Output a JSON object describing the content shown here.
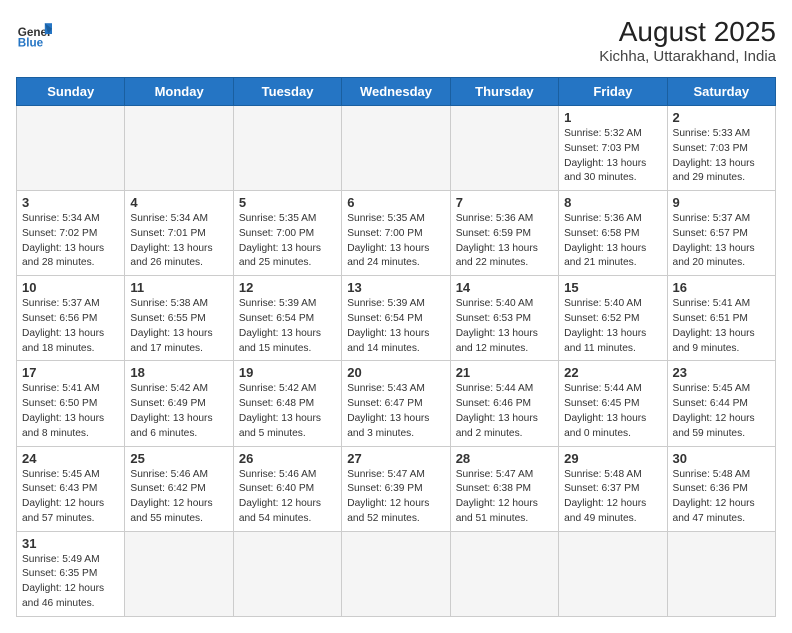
{
  "header": {
    "logo_general": "General",
    "logo_blue": "Blue",
    "title": "August 2025",
    "subtitle": "Kichha, Uttarakhand, India"
  },
  "days_of_week": [
    "Sunday",
    "Monday",
    "Tuesday",
    "Wednesday",
    "Thursday",
    "Friday",
    "Saturday"
  ],
  "weeks": [
    [
      {
        "day": "",
        "info": ""
      },
      {
        "day": "",
        "info": ""
      },
      {
        "day": "",
        "info": ""
      },
      {
        "day": "",
        "info": ""
      },
      {
        "day": "",
        "info": ""
      },
      {
        "day": "1",
        "info": "Sunrise: 5:32 AM\nSunset: 7:03 PM\nDaylight: 13 hours and 30 minutes."
      },
      {
        "day": "2",
        "info": "Sunrise: 5:33 AM\nSunset: 7:03 PM\nDaylight: 13 hours and 29 minutes."
      }
    ],
    [
      {
        "day": "3",
        "info": "Sunrise: 5:34 AM\nSunset: 7:02 PM\nDaylight: 13 hours and 28 minutes."
      },
      {
        "day": "4",
        "info": "Sunrise: 5:34 AM\nSunset: 7:01 PM\nDaylight: 13 hours and 26 minutes."
      },
      {
        "day": "5",
        "info": "Sunrise: 5:35 AM\nSunset: 7:00 PM\nDaylight: 13 hours and 25 minutes."
      },
      {
        "day": "6",
        "info": "Sunrise: 5:35 AM\nSunset: 7:00 PM\nDaylight: 13 hours and 24 minutes."
      },
      {
        "day": "7",
        "info": "Sunrise: 5:36 AM\nSunset: 6:59 PM\nDaylight: 13 hours and 22 minutes."
      },
      {
        "day": "8",
        "info": "Sunrise: 5:36 AM\nSunset: 6:58 PM\nDaylight: 13 hours and 21 minutes."
      },
      {
        "day": "9",
        "info": "Sunrise: 5:37 AM\nSunset: 6:57 PM\nDaylight: 13 hours and 20 minutes."
      }
    ],
    [
      {
        "day": "10",
        "info": "Sunrise: 5:37 AM\nSunset: 6:56 PM\nDaylight: 13 hours and 18 minutes."
      },
      {
        "day": "11",
        "info": "Sunrise: 5:38 AM\nSunset: 6:55 PM\nDaylight: 13 hours and 17 minutes."
      },
      {
        "day": "12",
        "info": "Sunrise: 5:39 AM\nSunset: 6:54 PM\nDaylight: 13 hours and 15 minutes."
      },
      {
        "day": "13",
        "info": "Sunrise: 5:39 AM\nSunset: 6:54 PM\nDaylight: 13 hours and 14 minutes."
      },
      {
        "day": "14",
        "info": "Sunrise: 5:40 AM\nSunset: 6:53 PM\nDaylight: 13 hours and 12 minutes."
      },
      {
        "day": "15",
        "info": "Sunrise: 5:40 AM\nSunset: 6:52 PM\nDaylight: 13 hours and 11 minutes."
      },
      {
        "day": "16",
        "info": "Sunrise: 5:41 AM\nSunset: 6:51 PM\nDaylight: 13 hours and 9 minutes."
      }
    ],
    [
      {
        "day": "17",
        "info": "Sunrise: 5:41 AM\nSunset: 6:50 PM\nDaylight: 13 hours and 8 minutes."
      },
      {
        "day": "18",
        "info": "Sunrise: 5:42 AM\nSunset: 6:49 PM\nDaylight: 13 hours and 6 minutes."
      },
      {
        "day": "19",
        "info": "Sunrise: 5:42 AM\nSunset: 6:48 PM\nDaylight: 13 hours and 5 minutes."
      },
      {
        "day": "20",
        "info": "Sunrise: 5:43 AM\nSunset: 6:47 PM\nDaylight: 13 hours and 3 minutes."
      },
      {
        "day": "21",
        "info": "Sunrise: 5:44 AM\nSunset: 6:46 PM\nDaylight: 13 hours and 2 minutes."
      },
      {
        "day": "22",
        "info": "Sunrise: 5:44 AM\nSunset: 6:45 PM\nDaylight: 13 hours and 0 minutes."
      },
      {
        "day": "23",
        "info": "Sunrise: 5:45 AM\nSunset: 6:44 PM\nDaylight: 12 hours and 59 minutes."
      }
    ],
    [
      {
        "day": "24",
        "info": "Sunrise: 5:45 AM\nSunset: 6:43 PM\nDaylight: 12 hours and 57 minutes."
      },
      {
        "day": "25",
        "info": "Sunrise: 5:46 AM\nSunset: 6:42 PM\nDaylight: 12 hours and 55 minutes."
      },
      {
        "day": "26",
        "info": "Sunrise: 5:46 AM\nSunset: 6:40 PM\nDaylight: 12 hours and 54 minutes."
      },
      {
        "day": "27",
        "info": "Sunrise: 5:47 AM\nSunset: 6:39 PM\nDaylight: 12 hours and 52 minutes."
      },
      {
        "day": "28",
        "info": "Sunrise: 5:47 AM\nSunset: 6:38 PM\nDaylight: 12 hours and 51 minutes."
      },
      {
        "day": "29",
        "info": "Sunrise: 5:48 AM\nSunset: 6:37 PM\nDaylight: 12 hours and 49 minutes."
      },
      {
        "day": "30",
        "info": "Sunrise: 5:48 AM\nSunset: 6:36 PM\nDaylight: 12 hours and 47 minutes."
      }
    ],
    [
      {
        "day": "31",
        "info": "Sunrise: 5:49 AM\nSunset: 6:35 PM\nDaylight: 12 hours and 46 minutes."
      },
      {
        "day": "",
        "info": ""
      },
      {
        "day": "",
        "info": ""
      },
      {
        "day": "",
        "info": ""
      },
      {
        "day": "",
        "info": ""
      },
      {
        "day": "",
        "info": ""
      },
      {
        "day": "",
        "info": ""
      }
    ]
  ]
}
